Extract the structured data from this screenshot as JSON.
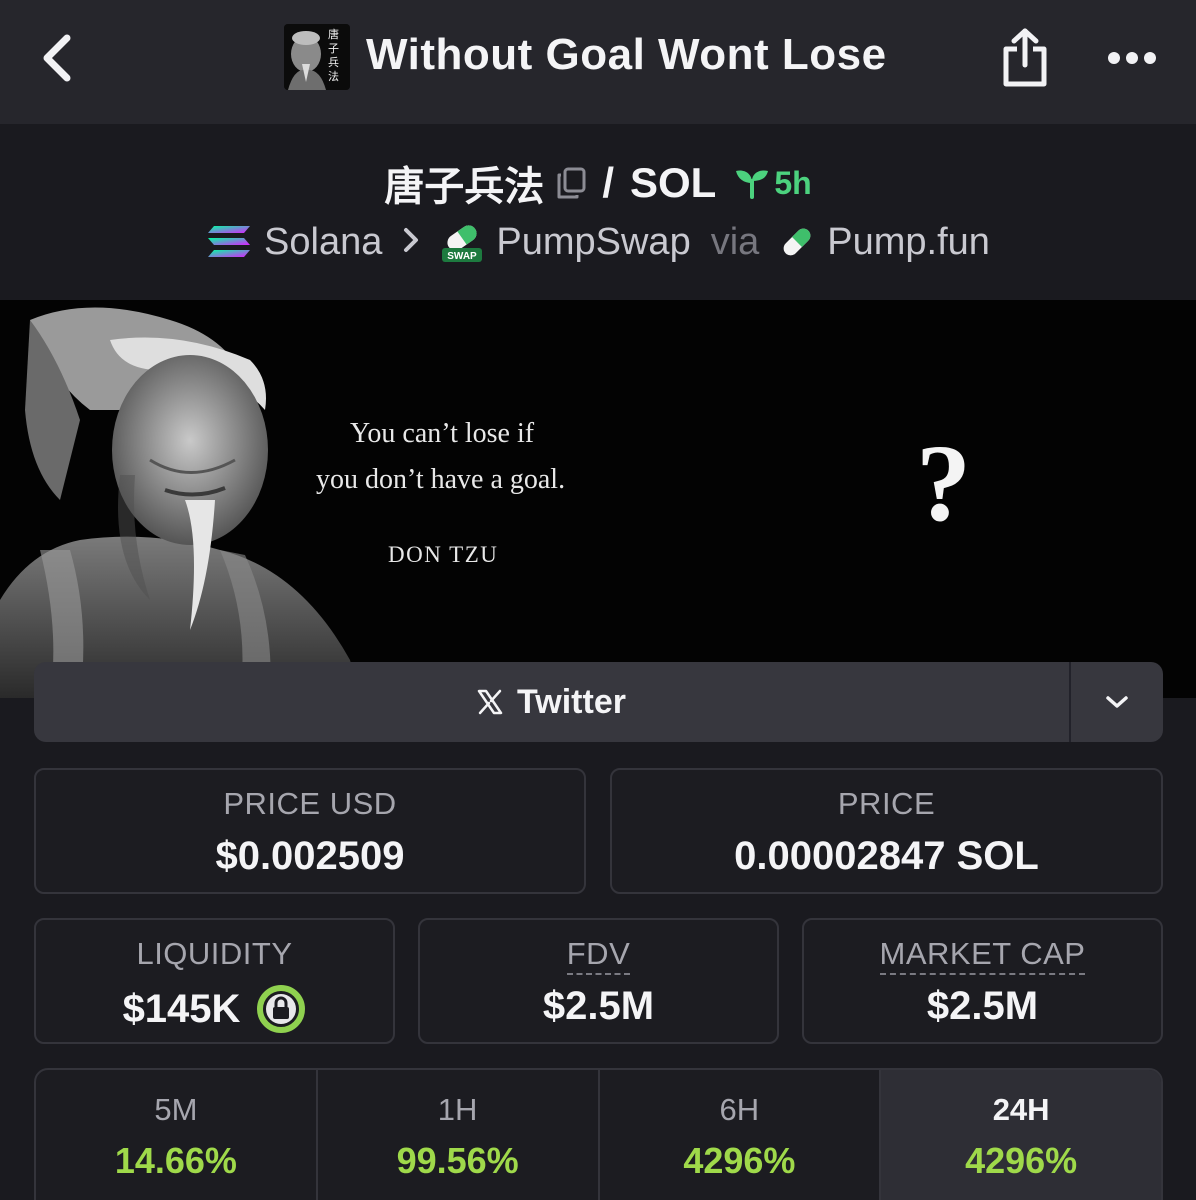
{
  "header": {
    "title": "Without Goal Wont Lose",
    "thumb_text": "唐子兵法",
    "back_icon": "chevron-left-icon",
    "share_icon": "share-icon",
    "more_icon": "more-dots-icon"
  },
  "pair": {
    "token": "唐子兵法",
    "separator": "/",
    "quote": "SOL",
    "age": "5h",
    "chain": "Solana",
    "dex": "PumpSwap",
    "via": "via",
    "launchpad": "Pump.fun",
    "dex_badge": "SWAP"
  },
  "banner": {
    "line1": "You can’t lose if",
    "line2": "you don’t have a goal.",
    "author": "DON TZU",
    "mark": "?"
  },
  "social": {
    "twitter_label": "Twitter"
  },
  "stats": {
    "price_usd_label": "PRICE USD",
    "price_usd_value": "$0.002509",
    "price_label": "PRICE",
    "price_value": "0.00002847 SOL",
    "liquidity_label": "LIQUIDITY",
    "liquidity_value": "$145K",
    "fdv_label": "FDV",
    "fdv_value": "$2.5M",
    "mcap_label": "MARKET CAP",
    "mcap_value": "$2.5M"
  },
  "timeframes": [
    {
      "label": "5M",
      "change": "14.66%"
    },
    {
      "label": "1H",
      "change": "99.56%"
    },
    {
      "label": "6H",
      "change": "4296%"
    },
    {
      "label": "24H",
      "change": "4296%"
    }
  ],
  "colors": {
    "positive": "#9fd94a",
    "age_green": "#4cd27e",
    "background": "#1a1a1f",
    "header": "#26262c"
  }
}
